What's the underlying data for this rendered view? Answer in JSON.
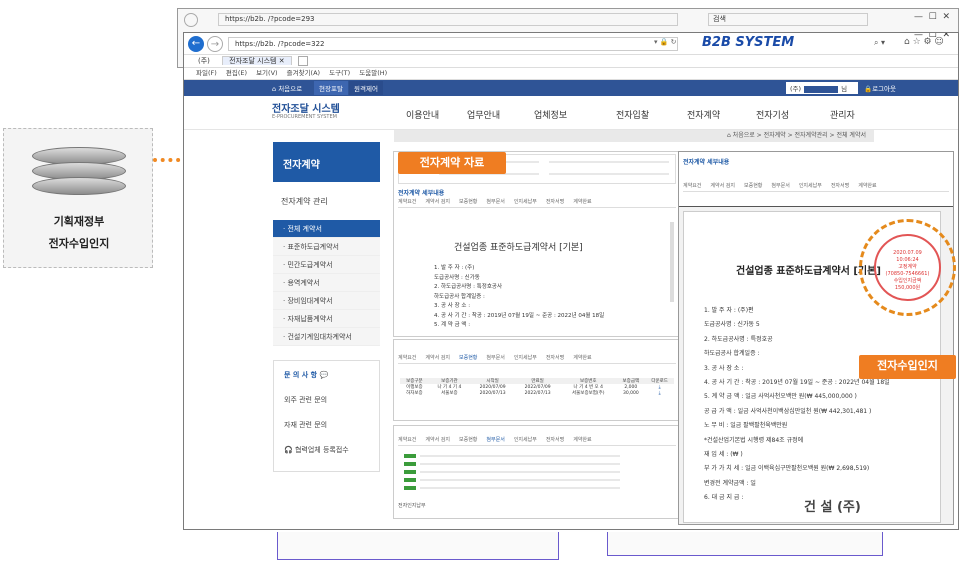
{
  "server": {
    "line1": "기획재정부",
    "line2": "전자수입인지"
  },
  "back_window": {
    "address": "https://b2b.          /?pcode=293",
    "search": "검색"
  },
  "browser": {
    "address": "https://b2b.          /?pcode=322",
    "brand": "B2B SYSTEM",
    "tab_prefix": "(주)",
    "tab_label": "전자조달 시스템",
    "menu": [
      "파일(F)",
      "편집(E)",
      "보기(V)",
      "즐겨찾기(A)",
      "도구(T)",
      "도움말(H)"
    ]
  },
  "topbar": {
    "home": "처음으로",
    "b1": "현장포탈",
    "b2": "원격제어",
    "user_prefix": "(주)",
    "user_suffix": "님",
    "logout": "로그아웃"
  },
  "site": {
    "title": "전자조달 시스템",
    "subtitle": "E-PROCUREMENT SYSTEM",
    "nav": [
      "이용안내",
      "업무안내",
      "업체정보",
      "전자입찰",
      "전자계약",
      "전자기성",
      "관리자"
    ],
    "breadcrumb": "처음으로 > 전자계약 > 전자계약관리 > 전체 계약서"
  },
  "sidebar": {
    "heading": "전자계약",
    "sub": "전자계약 관리",
    "items": [
      "전체 계약서",
      "표준하도급계약서",
      "민간도급계약서",
      "용역계약서",
      "장비임대계약서",
      "자재납품계약서",
      "건설기계임대차계약서"
    ],
    "qna_title": "문 의 사 항",
    "qna_items": [
      "외주 관련 문의",
      "자재 관련 문의",
      "협력업체 등록접수"
    ]
  },
  "callouts": {
    "doc": "전자계약 자료",
    "stamp": "전자수입인지"
  },
  "doc_panel": {
    "section": "전자계약 세부내용",
    "tabs": [
      "계약요건",
      "계약서 검지",
      "보증현황",
      "첨부문서",
      "인지세납부",
      "전자서명",
      "계약완료"
    ],
    "doc_title": "건설업종 표준하도급계약서 [기본]",
    "lines": [
      "1. 발  주  자 : (주)",
      "   도급공사명 : 신가동",
      "2. 하도급공사명 : 특정호공사",
      "   하도급공사 합계일증 :",
      "3. 공 사 장 소 :",
      "4. 공 사 기 간 : 착공 : 2019년 07월 19일 ~ 준공 : 2022년 04월 18일",
      "5. 계 약 금 액 :"
    ]
  },
  "table_panel": {
    "tabs": [
      "계약요건",
      "계약서 검지",
      "보증현황",
      "첨부문서",
      "인지세납부",
      "전자서명",
      "계약완료"
    ],
    "headers": [
      "보증구분",
      "보증기관",
      "시작일",
      "만료일",
      "보증번호",
      "보증금액",
      "다운로드"
    ],
    "rows": [
      [
        "이행보증",
        "나 기 4 기 4",
        "2020/07/09",
        "2022/07/09",
        "나 기 4 번 오 4",
        "2,000",
        "⤓"
      ],
      [
        "하자보증",
        "서울보증",
        "2020/07/13",
        "2022/07/13",
        "서울보증보험(주)",
        "30,000",
        "⤓"
      ]
    ]
  },
  "files_panel": {
    "tabs": [
      "계약요건",
      "계약서 검지",
      "보증현황",
      "첨부문서",
      "인지세납부",
      "전자서명",
      "계약완료"
    ],
    "footer_label": "전자인지납부"
  },
  "right_doc": {
    "section": "전자계약 세부내용",
    "tabs": [
      "계약요건",
      "계약서 검지",
      "보증현황",
      "첨부문서",
      "인지세납부",
      "전자서명",
      "계약완료"
    ],
    "title": "건설업종 표준하도급계약서 [기본]",
    "lines": [
      "1. 발  주  자 : (주)편",
      "   도급공사명 : 신가동 5",
      "2. 하도급공사명 : 특정호공",
      "   하도급공사 합계일증 :",
      "3. 공 사 장 소 :",
      "4. 공 사 기 간 : 착공 : 2019년 07월 19일 ~ 준공 : 2022년 04월 18일",
      "5. 계 약 금 액 : 일금 사억사천오백만 원(₩ 445,000,000 )",
      "   공 급 가 액 : 일금 사억사천이백삼십만일천 원(₩ 442,301,481 )",
      "   노 무 비 : 일금 팔백팔천육백만원",
      "   *건설산업기본법 시행령 제84조 규정에",
      "   재 입 세 : (₩ )",
      "   부 가 가 치 세 : 일금 이백육십구만팔천오백원 원(₩ 2,698,519)",
      "   변경전 계약금액 : 일",
      "6. 대 금 지 급 :"
    ],
    "company": "건 설 (주)"
  },
  "stamp": {
    "date": "2020.07.09",
    "time": "10:06:24",
    "type": "고정계약",
    "code": "(70850-7546661)",
    "label": "수입인지금액",
    "amount": "150,000원"
  }
}
